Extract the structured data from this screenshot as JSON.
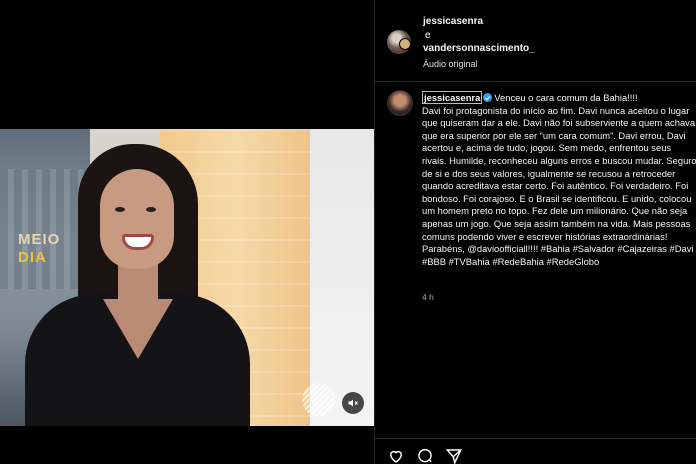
{
  "video": {
    "show_logo_line1": "MEIO",
    "show_logo_line2": "DIA",
    "mute_icon": "speaker-muted-icon"
  },
  "header": {
    "author_a": "jessicasenra",
    "connector": "e",
    "author_b": "vandersonnascimento_",
    "audio": "Áudio original"
  },
  "caption": {
    "author": "jessicasenra",
    "text": "Venceu o cara comum da Bahia!!!!\nDavi foi protagonista do início ao fim. Davi nunca aceitou o lugar que quiseram dar a ele. Davi não foi subserviente a quem achava que era superior por ele ser “um cara comum”. Davi errou, Davi acertou e, acima de tudo, jogou. Sem medo, enfrentou seus rivais. Humilde, reconheceu alguns erros e buscou mudar. Seguro de si e dos seus valores, igualmente se recusou a retroceder quando acreditava estar certo. Foi autêntico. Foi verdadeiro. Foi bondoso. Foi corajoso. E o Brasil se identificou. E unido, colocou um homem preto no topo. Fez dele um milionário. Que não seja apenas um jogo. Que seja assim também na vida. Mais pessoas comuns podendo viver e escrever histórias extraordinárias! Parabéns, @davioofficiall!!!! #Bahia #Salvador #Cajazeiras #Davi #BBB #TVBahia #RedeBahia #RedeGlobo",
    "timestamp": "4 h"
  },
  "actions": {
    "like_icon": "heart-icon",
    "comment_icon": "comment-icon",
    "share_icon": "send-icon"
  },
  "colors": {
    "background": "#000000",
    "verified": "#3897f0",
    "divider": "#262626"
  }
}
